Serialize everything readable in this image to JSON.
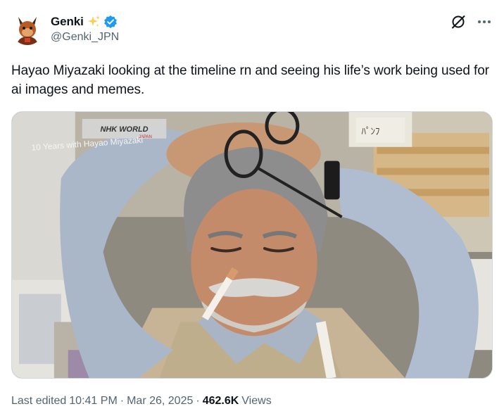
{
  "author": {
    "display_name": "Genki",
    "handle": "@Genki_JPN",
    "emoji": "sparkles",
    "verified": true
  },
  "tweet": {
    "text": "Hayao Miyazaki looking at the timeline rn and seeing his life’s work being used for ai images and memes."
  },
  "media": {
    "logo_text": "NHK WORLD",
    "logo_subtext": "JAPAN",
    "caption_text": "10 Years with Hayao Miyazaki",
    "note_text": "ﾊﾟﾝﾌ"
  },
  "footer": {
    "edited_label": "Last edited",
    "time": "10:41 PM",
    "date": "Mar 26, 2025",
    "views_count": "462.6K",
    "views_label": "Views",
    "separator": "·"
  },
  "colors": {
    "text_primary": "#0f1419",
    "text_secondary": "#536471",
    "verified_blue": "#1d9bf0",
    "sparkle_yellow": "#ffcc4d"
  },
  "icons": [
    "avatar-image",
    "sparkles-icon",
    "verified-badge-icon",
    "grok-icon",
    "more-options-icon"
  ]
}
